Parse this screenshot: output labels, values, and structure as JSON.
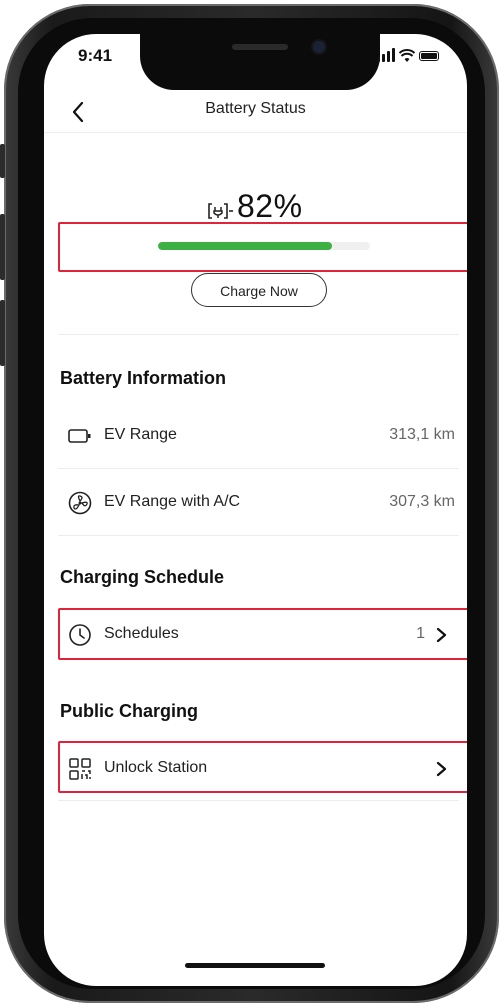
{
  "status_bar": {
    "time": "9:41"
  },
  "nav": {
    "title": "Battery Status"
  },
  "battery": {
    "percent_label": "82%",
    "level": 0.82,
    "charge_button": "Charge Now",
    "fill_color": "#3cb043"
  },
  "battery_info": {
    "title": "Battery Information",
    "rows": [
      {
        "label": "EV Range",
        "value": "313,1 km",
        "icon": "battery-icon"
      },
      {
        "label": "EV Range with A/C",
        "value": "307,3 km",
        "icon": "fan-icon"
      }
    ]
  },
  "charging_schedule": {
    "title": "Charging Schedule",
    "row": {
      "label": "Schedules",
      "count": "1",
      "icon": "clock-icon"
    }
  },
  "public_charging": {
    "title": "Public Charging",
    "row": {
      "label": "Unlock Station",
      "icon": "qr-code-icon"
    }
  },
  "colors": {
    "highlight": "#e0223a",
    "accent": "#3cb043"
  }
}
